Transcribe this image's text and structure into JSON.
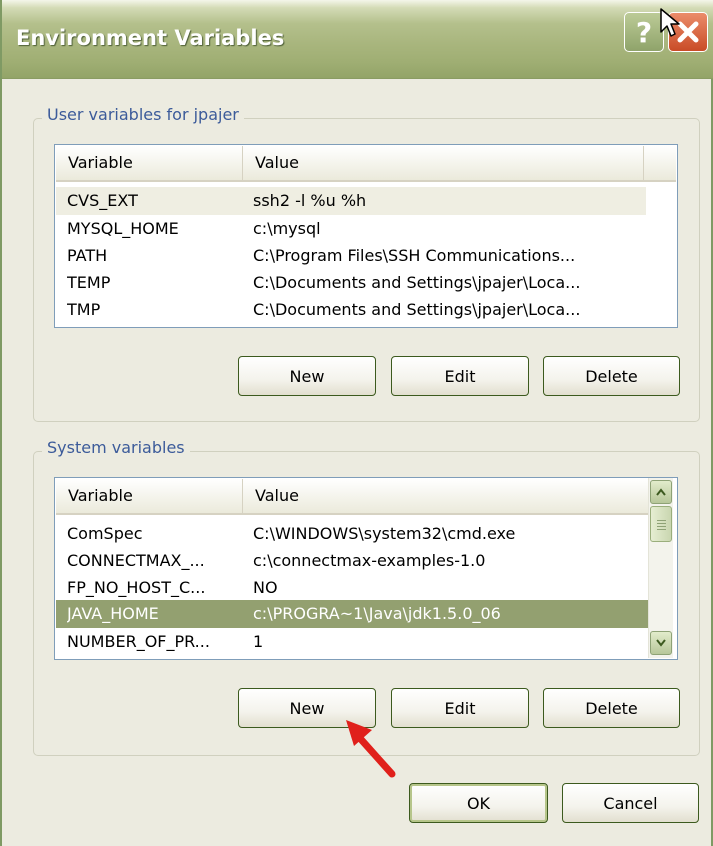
{
  "window": {
    "title": "Environment Variables",
    "help_icon": "question-mark-icon",
    "close_icon": "close-icon"
  },
  "user_group": {
    "legend": "User variables for jpajer",
    "columns": [
      "Variable",
      "Value"
    ],
    "rows": [
      {
        "name": "CVS_EXT",
        "value": "ssh2 -l %u %h",
        "state": "selected-inactive"
      },
      {
        "name": "MYSQL_HOME",
        "value": "c:\\mysql"
      },
      {
        "name": "PATH",
        "value": "C:\\Program Files\\SSH Communications..."
      },
      {
        "name": "TEMP",
        "value": "C:\\Documents and Settings\\jpajer\\Loca..."
      },
      {
        "name": "TMP",
        "value": "C:\\Documents and Settings\\jpajer\\Loca..."
      }
    ],
    "buttons": {
      "new": "New",
      "edit": "Edit",
      "delete": "Delete"
    }
  },
  "system_group": {
    "legend": "System variables",
    "columns": [
      "Variable",
      "Value"
    ],
    "rows": [
      {
        "name": "ComSpec",
        "value": "C:\\WINDOWS\\system32\\cmd.exe"
      },
      {
        "name": "CONNECTMAX_...",
        "value": "c:\\connectmax-examples-1.0"
      },
      {
        "name": "FP_NO_HOST_C...",
        "value": "NO"
      },
      {
        "name": "JAVA_HOME",
        "value": "c:\\PROGRA~1\\Java\\jdk1.5.0_06",
        "state": "selected"
      },
      {
        "name": "NUMBER_OF_PR...",
        "value": "1"
      }
    ],
    "buttons": {
      "new": "New",
      "edit": "Edit",
      "delete": "Delete"
    },
    "scrollbar": {
      "up_icon": "scroll-up-icon",
      "down_icon": "scroll-down-icon"
    }
  },
  "footer": {
    "ok": "OK",
    "cancel": "Cancel"
  },
  "annotations": {
    "pointer": "red-arrow-icon",
    "cursor": "mouse-cursor-icon"
  },
  "colors": {
    "accent": "#93a070",
    "title_bar": "#a9b67e",
    "close": "#c94c27",
    "legend_text": "#3c5b9a",
    "annotation_arrow": "#e0201b"
  }
}
